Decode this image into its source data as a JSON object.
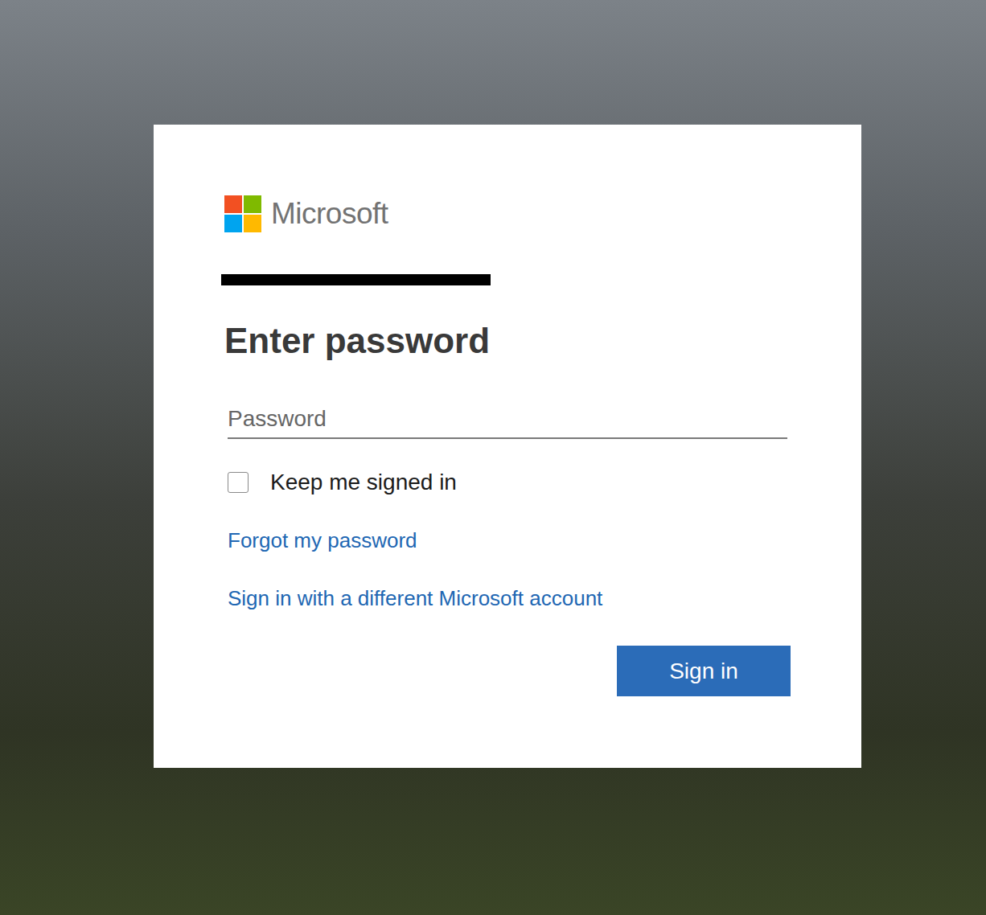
{
  "brand": "Microsoft",
  "account": {
    "redacted": true
  },
  "heading": "Enter password",
  "password_field": {
    "placeholder": "Password",
    "value": ""
  },
  "keep_signed_in": {
    "label": "Keep me signed in",
    "checked": false
  },
  "links": [
    "Forgot my password",
    "Sign in with a different Microsoft account"
  ],
  "buttons": [
    {
      "label": "Sign in"
    }
  ]
}
